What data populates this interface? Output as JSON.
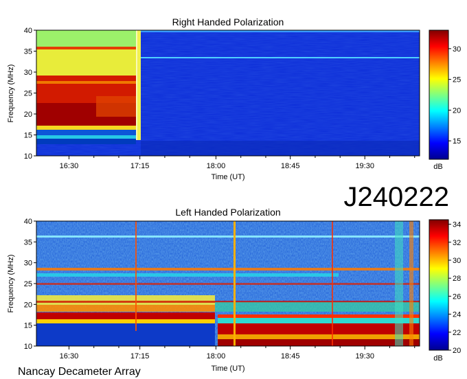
{
  "footer_label": "Nancay Decameter Array",
  "observation_id": "J240222",
  "chart_data": [
    {
      "type": "heatmap",
      "title": "Right Handed Polarization",
      "xlabel": "Time (UT)",
      "ylabel": "Frequency (MHz)",
      "colorbar_label": "dB",
      "x_tick_labels": [
        "16:30",
        "17:15",
        "18:00",
        "18:45",
        "19:30"
      ],
      "y_ticks": [
        10,
        15,
        20,
        25,
        30,
        35,
        40
      ],
      "ylim": [
        10,
        40
      ],
      "colorbar_ticks": [
        15,
        20,
        25,
        30
      ],
      "colorbar_range": [
        12,
        33
      ],
      "grid": false
    },
    {
      "type": "heatmap",
      "title": "Left Handed Polarization",
      "xlabel": "Time (UT)",
      "ylabel": "Frequency (MHz)",
      "colorbar_label": "dB",
      "x_tick_labels": [
        "16:30",
        "17:15",
        "18:00",
        "18:45",
        "19:30"
      ],
      "y_ticks": [
        10,
        15,
        20,
        25,
        30,
        35,
        40
      ],
      "ylim": [
        10,
        40
      ],
      "colorbar_ticks": [
        20,
        22,
        24,
        26,
        28,
        30,
        32,
        34
      ],
      "colorbar_range": [
        20,
        34.5
      ],
      "grid": false
    }
  ]
}
